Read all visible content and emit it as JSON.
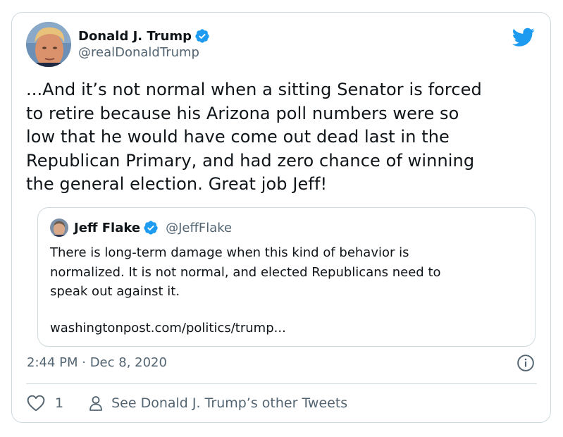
{
  "author": {
    "name": "Donald J. Trump",
    "handle": "@realDonaldTrump",
    "verified_icon": "verified-badge-icon",
    "avatar": "avatar"
  },
  "brand": {
    "icon": "twitter-bird-icon",
    "color": "#1d9bf0"
  },
  "tweet": {
    "lines": [
      "...And it’s not normal when a sitting Senator is forced",
      "to retire because his Arizona poll numbers were so",
      "low that he would have come out dead last in the",
      "Republican Primary, and had zero chance of winning",
      "the general election. Great job Jeff!"
    ]
  },
  "quote": {
    "name": "Jeff Flake",
    "handle": "@JeffFlake",
    "lines": [
      "There is long-term damage when this kind of behavior is",
      "normalized. It is not normal, and elected Republicans need to",
      "speak out against it."
    ],
    "link": "washingtonpost.com/politics/trump..."
  },
  "meta": {
    "timestamp": "2:44 PM · Dec 8, 2020",
    "info_icon": "info-icon"
  },
  "actions": {
    "like_count": "1",
    "see_other": "See Donald J. Trump’s other Tweets"
  },
  "colors": {
    "text": "#0f1419",
    "secondary": "#536471",
    "border": "#cfd9de",
    "verified": "#1d9bf0"
  }
}
